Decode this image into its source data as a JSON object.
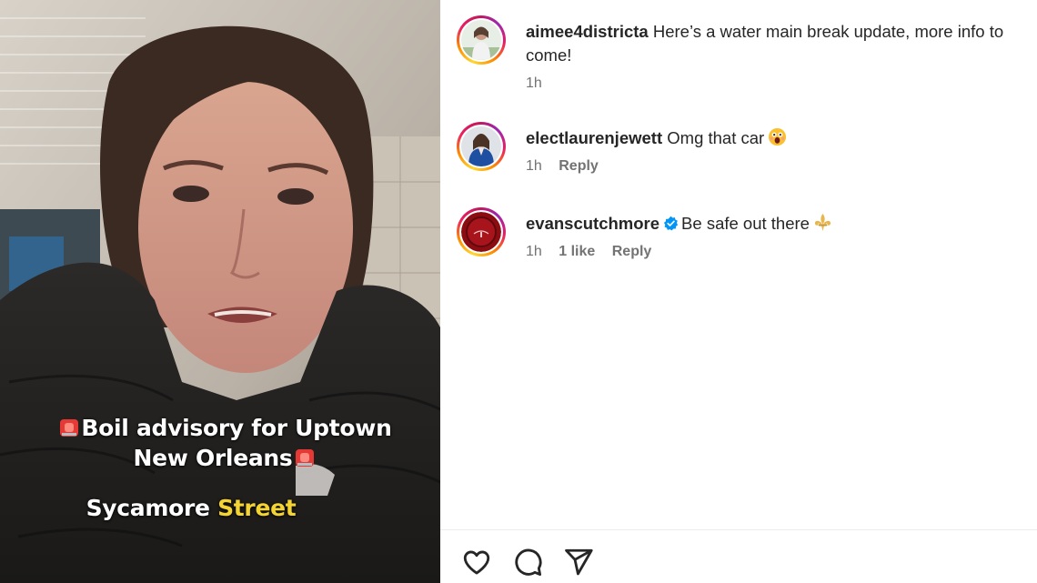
{
  "video": {
    "caption_line1_text": "Boil advisory for Uptown",
    "caption_line2_text": "New Orleans",
    "caption_line3_white": "Sycamore",
    "caption_line3_yellow": "Street",
    "highlight_color": "#f4d432",
    "caption_icon": "siren-emoji"
  },
  "post": {
    "username": "aimee4districta",
    "caption": "Here’s a water main break update, more info to come!",
    "time": "1h"
  },
  "comments": [
    {
      "username": "electlaurenjewett",
      "text": "Omg that car",
      "emoji": "astonished-face-emoji",
      "time": "1h",
      "reply_label": "Reply"
    },
    {
      "username": "evanscutchmore",
      "verified": true,
      "verified_icon": "verified-badge-icon",
      "text": "Be safe out there",
      "emoji": "fleur-de-lis-emoji",
      "time": "1h",
      "likes": "1 like",
      "reply_label": "Reply"
    }
  ],
  "actions": {
    "icons": [
      "heart-icon",
      "comment-icon",
      "share-icon"
    ]
  },
  "colors": {
    "ring_gradient_start": "#fdd835",
    "ring_gradient_end": "#c2185b",
    "verified_blue": "#0095f6",
    "meta_gray": "#737373"
  }
}
